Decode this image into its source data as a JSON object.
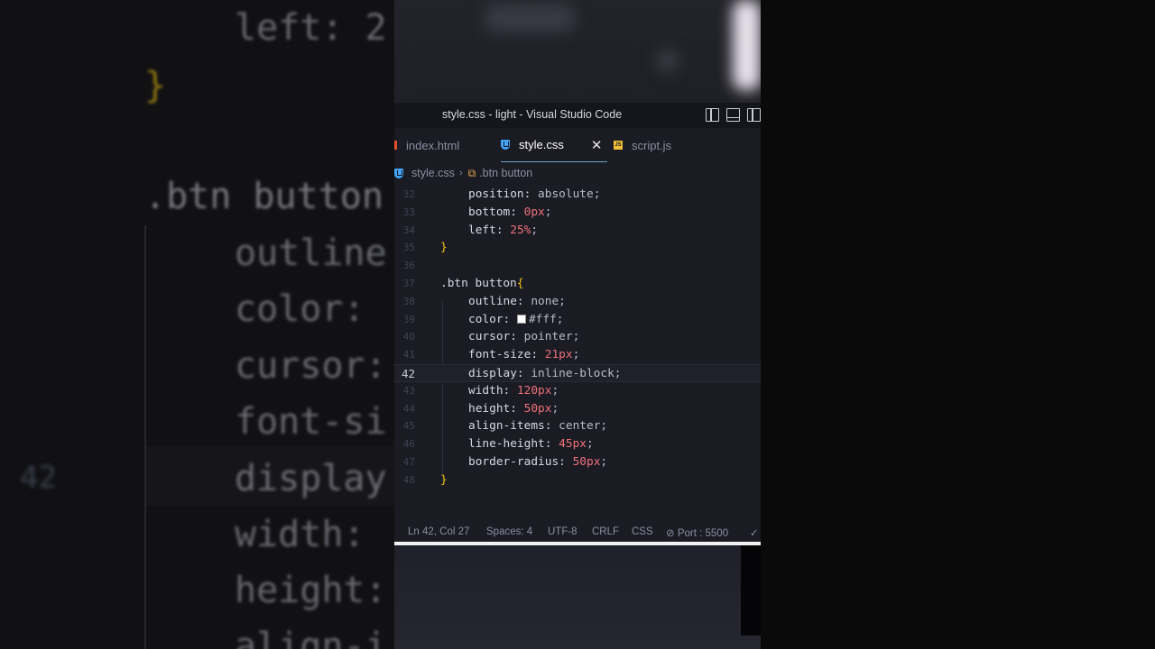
{
  "background_zoom": {
    "lines": [
      {
        "text": "left: 2",
        "color": "#b0b3bc"
      },
      {
        "text": "}",
        "color": "#f1c40f"
      },
      {
        "text": ".btn button",
        "color": "#c9ccd6"
      },
      {
        "text": "outline",
        "color": "#b0b3bc"
      },
      {
        "text": "color: ",
        "color": "#b0b3bc"
      },
      {
        "text": "cursor:",
        "color": "#b0b3bc"
      },
      {
        "text": "font-si",
        "color": "#b0b3bc"
      },
      {
        "text": "display",
        "color": "#b0b3bc"
      },
      {
        "text": "width: ",
        "color": "#b0b3bc"
      },
      {
        "text": "height:",
        "color": "#b0b3bc"
      },
      {
        "text": "align-i",
        "color": "#b0b3bc"
      }
    ],
    "current_line_number": "42"
  },
  "window": {
    "title": "style.css - light - Visual Studio Code"
  },
  "tabs": [
    {
      "label": "index.html",
      "icon": "html-file-icon",
      "active": false
    },
    {
      "label": "style.css",
      "icon": "css-file-icon",
      "active": true
    },
    {
      "label": "script.js",
      "icon": "js-file-icon",
      "active": false
    }
  ],
  "breadcrumb": {
    "file": "style.css",
    "symbol": ".btn button"
  },
  "editor": {
    "lines": [
      {
        "num": "32",
        "prop": "position: ",
        "value": "absolute",
        "value_type": "kw",
        "indent": true
      },
      {
        "num": "33",
        "prop": "bottom: ",
        "value": "0px",
        "value_type": "num",
        "indent": true
      },
      {
        "num": "34",
        "prop": "left: ",
        "value": "25%",
        "value_type": "num",
        "indent": true
      },
      {
        "num": "35",
        "prop": "}",
        "value": "",
        "value_type": "brace",
        "indent": false
      },
      {
        "num": "36",
        "prop": "",
        "value": "",
        "value_type": "none",
        "indent": false
      },
      {
        "num": "37",
        "prop": ".btn button",
        "value": "{",
        "value_type": "selector",
        "indent": false
      },
      {
        "num": "38",
        "prop": "outline: ",
        "value": "none",
        "value_type": "kw",
        "indent": true
      },
      {
        "num": "39",
        "prop": "color: ",
        "value": "#fff",
        "value_type": "color",
        "indent": true
      },
      {
        "num": "40",
        "prop": "cursor: ",
        "value": "pointer",
        "value_type": "kw",
        "indent": true
      },
      {
        "num": "41",
        "prop": "font-size: ",
        "value": "21px",
        "value_type": "num",
        "indent": true
      },
      {
        "num": "42",
        "prop": "display: ",
        "value": "inline-block",
        "value_type": "kw",
        "indent": true,
        "current": true
      },
      {
        "num": "43",
        "prop": "width: ",
        "value": "120px",
        "value_type": "num",
        "indent": true
      },
      {
        "num": "44",
        "prop": "height: ",
        "value": "50px",
        "value_type": "num",
        "indent": true
      },
      {
        "num": "45",
        "prop": "align-items: ",
        "value": "center",
        "value_type": "kw",
        "indent": true
      },
      {
        "num": "46",
        "prop": "line-height: ",
        "value": "45px",
        "value_type": "num",
        "indent": true
      },
      {
        "num": "47",
        "prop": "border-radius: ",
        "value": "50px",
        "value_type": "num",
        "indent": true
      },
      {
        "num": "48",
        "prop": "}",
        "value": "",
        "value_type": "brace",
        "indent": false
      }
    ]
  },
  "statusbar": {
    "position": "Ln 42, Col 27",
    "spaces": "Spaces: 4",
    "encoding": "UTF-8",
    "eol": "CRLF",
    "language": "CSS",
    "port": "Port : 5500"
  },
  "colors": {
    "editor_bg": "#1b1b24",
    "number": "#f07178",
    "brace": "#f1c40f",
    "accent_tab": "#6ea8c8"
  }
}
